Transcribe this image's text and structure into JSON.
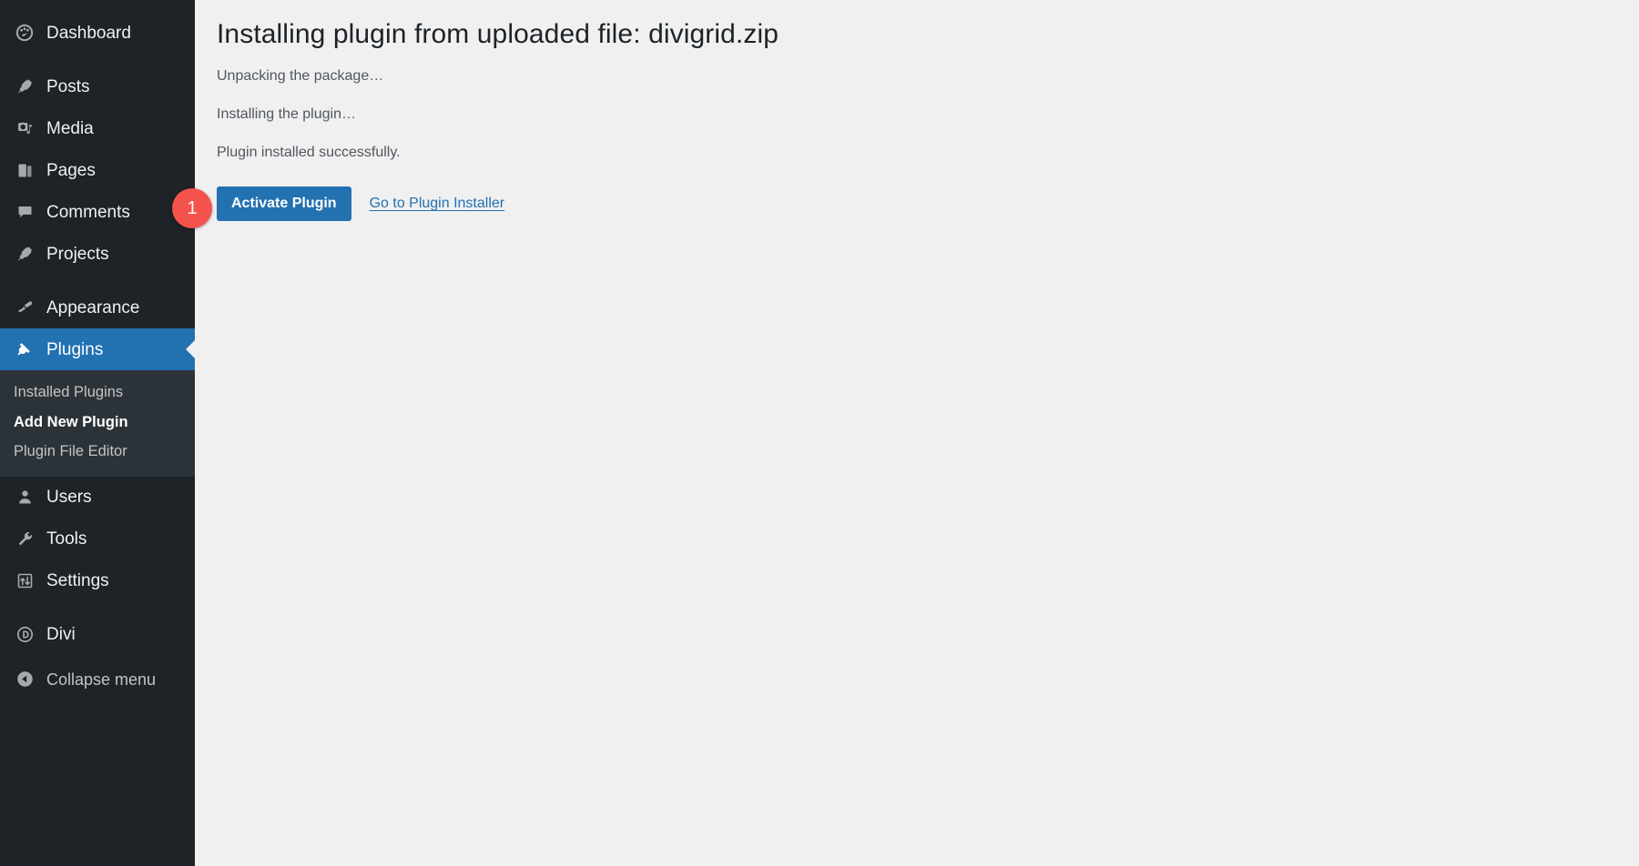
{
  "colors": {
    "sidebar_bg": "#1d2327",
    "submenu_bg": "#2c3338",
    "accent_blue": "#2271b1",
    "content_bg": "#f0f0f1",
    "badge_red": "#f4524d",
    "heading_text": "#1d2327",
    "body_text": "#50575e"
  },
  "sidebar": {
    "groups": [
      {
        "items": [
          {
            "label": "Dashboard",
            "icon": "dashboard-icon",
            "current": false
          }
        ]
      },
      {
        "items": [
          {
            "label": "Posts",
            "icon": "pin-icon",
            "current": false
          },
          {
            "label": "Media",
            "icon": "media-icon",
            "current": false
          },
          {
            "label": "Pages",
            "icon": "pages-icon",
            "current": false
          },
          {
            "label": "Comments",
            "icon": "comments-icon",
            "current": false
          },
          {
            "label": "Projects",
            "icon": "pin-icon",
            "current": false
          }
        ]
      },
      {
        "items": [
          {
            "label": "Appearance",
            "icon": "appearance-brush-icon",
            "current": false
          },
          {
            "label": "Plugins",
            "icon": "plugins-plug-icon",
            "current": true
          }
        ]
      }
    ],
    "submenu": {
      "parent": "Plugins",
      "items": [
        {
          "label": "Installed Plugins",
          "current": false
        },
        {
          "label": "Add New Plugin",
          "current": true
        },
        {
          "label": "Plugin File Editor",
          "current": false
        }
      ]
    },
    "groups_after": [
      {
        "items": [
          {
            "label": "Users",
            "icon": "users-icon",
            "current": false
          },
          {
            "label": "Tools",
            "icon": "tools-wrench-icon",
            "current": false
          },
          {
            "label": "Settings",
            "icon": "settings-sliders-icon",
            "current": false
          }
        ]
      },
      {
        "items": [
          {
            "label": "Divi",
            "icon": "divi-icon",
            "current": false
          }
        ]
      }
    ],
    "collapse": {
      "label": "Collapse menu",
      "icon": "collapse-arrow-icon"
    }
  },
  "main": {
    "page_title": "Installing plugin from uploaded file: divigrid.zip",
    "log_lines": [
      "Unpacking the package…",
      "Installing the plugin…",
      "Plugin installed successfully."
    ],
    "actions": {
      "activate_label": "Activate Plugin",
      "installer_link_label": "Go to Plugin Installer"
    }
  },
  "annotation": {
    "step_badge": "1"
  }
}
